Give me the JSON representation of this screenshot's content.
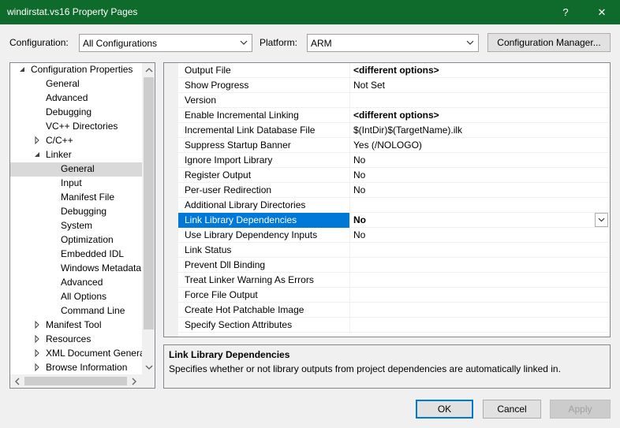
{
  "window": {
    "title": "windirstat.vs16 Property Pages",
    "help": "?",
    "close": "✕"
  },
  "toolbar": {
    "configuration_label": "Configuration:",
    "configuration_value": "All Configurations",
    "platform_label": "Platform:",
    "platform_value": "ARM",
    "config_manager": "Configuration Manager..."
  },
  "tree": {
    "items": [
      {
        "label": "Configuration Properties",
        "expander": "expanded"
      },
      {
        "label": "General"
      },
      {
        "label": "Advanced"
      },
      {
        "label": "Debugging"
      },
      {
        "label": "VC++ Directories"
      },
      {
        "label": "C/C++",
        "expander": "collapsed"
      },
      {
        "label": "Linker",
        "expander": "expanded"
      },
      {
        "label": "General",
        "selected": true
      },
      {
        "label": "Input"
      },
      {
        "label": "Manifest File"
      },
      {
        "label": "Debugging"
      },
      {
        "label": "System"
      },
      {
        "label": "Optimization"
      },
      {
        "label": "Embedded IDL"
      },
      {
        "label": "Windows Metadata"
      },
      {
        "label": "Advanced"
      },
      {
        "label": "All Options"
      },
      {
        "label": "Command Line"
      },
      {
        "label": "Manifest Tool",
        "expander": "collapsed"
      },
      {
        "label": "Resources",
        "expander": "collapsed"
      },
      {
        "label": "XML Document Genera",
        "expander": "collapsed"
      },
      {
        "label": "Browse Information",
        "expander": "collapsed"
      }
    ]
  },
  "grid": {
    "rows": [
      {
        "name": "Output File",
        "value": "<different options>",
        "bold": true
      },
      {
        "name": "Show Progress",
        "value": "Not Set"
      },
      {
        "name": "Version",
        "value": ""
      },
      {
        "name": "Enable Incremental Linking",
        "value": "<different options>",
        "bold": true
      },
      {
        "name": "Incremental Link Database File",
        "value": "$(IntDir)$(TargetName).ilk"
      },
      {
        "name": "Suppress Startup Banner",
        "value": "Yes (/NOLOGO)"
      },
      {
        "name": "Ignore Import Library",
        "value": "No"
      },
      {
        "name": "Register Output",
        "value": "No"
      },
      {
        "name": "Per-user Redirection",
        "value": "No"
      },
      {
        "name": "Additional Library Directories",
        "value": ""
      },
      {
        "name": "Link Library Dependencies",
        "value": "No",
        "selected": true
      },
      {
        "name": "Use Library Dependency Inputs",
        "value": "No"
      },
      {
        "name": "Link Status",
        "value": ""
      },
      {
        "name": "Prevent Dll Binding",
        "value": ""
      },
      {
        "name": "Treat Linker Warning As Errors",
        "value": ""
      },
      {
        "name": "Force File Output",
        "value": ""
      },
      {
        "name": "Create Hot Patchable Image",
        "value": ""
      },
      {
        "name": "Specify Section Attributes",
        "value": ""
      }
    ]
  },
  "description": {
    "title": "Link Library Dependencies",
    "text": "Specifies whether or not library outputs from project dependencies are automatically linked in."
  },
  "buttons": {
    "ok": "OK",
    "cancel": "Cancel",
    "apply": "Apply"
  }
}
